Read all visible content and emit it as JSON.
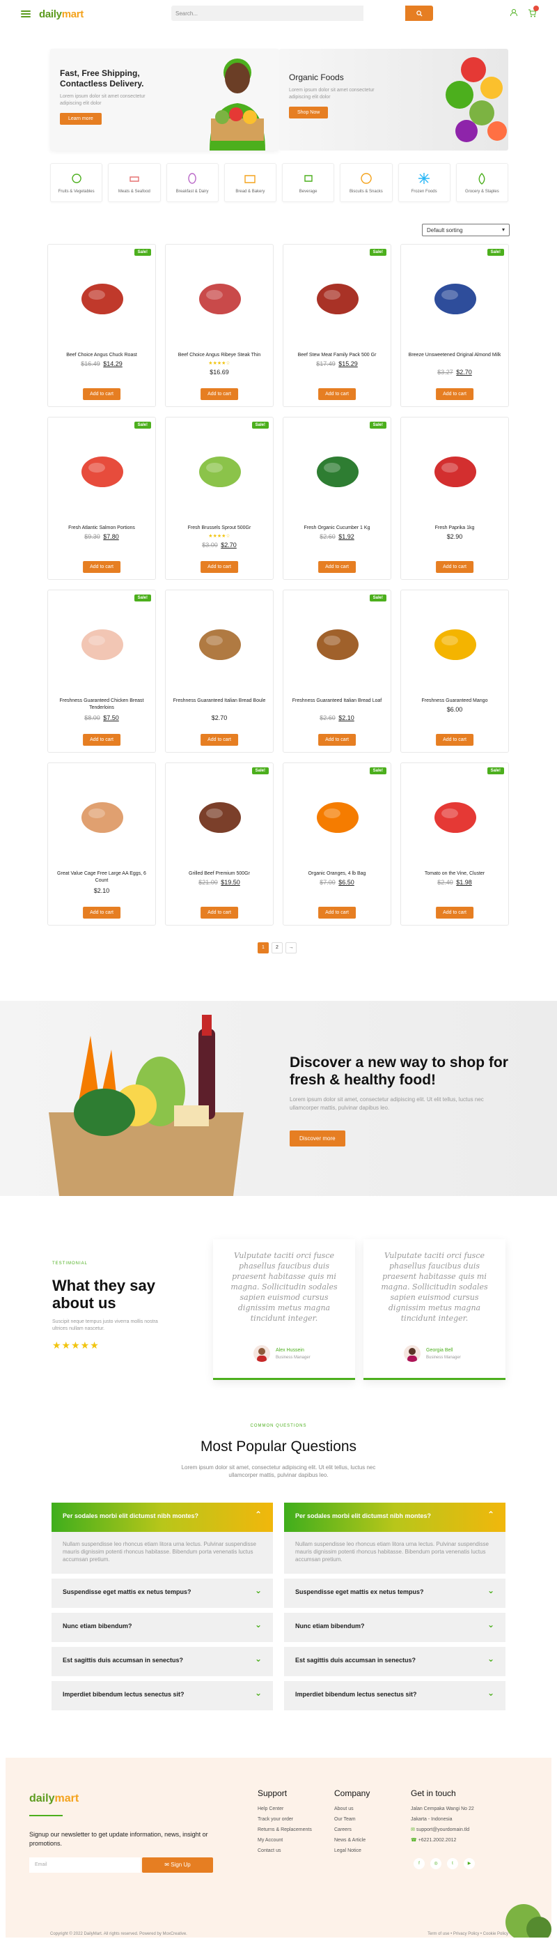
{
  "header": {
    "logo_main": "daily",
    "logo_accent": "mart",
    "search_placeholder": "Search..."
  },
  "banners": [
    {
      "title": "Fast, Free Shipping, Contactless Delivery.",
      "text": "Lorem ipsum dolor sit amet consectetur adipiscing elit dolor",
      "button": "Learn more"
    },
    {
      "title": "Organic Foods",
      "text": "Lorem ipsum dolor sit amet consectetur adipiscing elit dolor",
      "button": "Shop Now"
    }
  ],
  "categories": [
    {
      "label": "Fruits & Vegetables",
      "icon": "fruits-icon"
    },
    {
      "label": "Meats & Seafood",
      "icon": "meat-icon"
    },
    {
      "label": "Breakfast & Dairy",
      "icon": "egg-icon"
    },
    {
      "label": "Bread & Bakery",
      "icon": "bread-icon"
    },
    {
      "label": "Beverage",
      "icon": "coffee-icon"
    },
    {
      "label": "Biscuits & Snacks",
      "icon": "cookie-icon"
    },
    {
      "label": "Frozen Foods",
      "icon": "snowflake-icon"
    },
    {
      "label": "Grocery & Staples",
      "icon": "grocery-icon"
    }
  ],
  "sorting": {
    "selected": "Default sorting"
  },
  "products": [
    {
      "name": "Beef Choice Angus Chuck Roast",
      "old": "$16.49",
      "price": "$14.29",
      "sale": true,
      "stars": "",
      "color": "#c0392b"
    },
    {
      "name": "Beef Choice Angus Ribeye Steak Thin",
      "old": "",
      "price": "$16.69",
      "sale": false,
      "stars": "★★★★☆",
      "color": "#c94a4a"
    },
    {
      "name": "Beef Stew Meat Family Pack 500 Gr",
      "old": "$17.49",
      "price": "$15.29",
      "sale": true,
      "stars": "",
      "color": "#a93226"
    },
    {
      "name": "Breeze Unsweetened Original Almond Milk",
      "old": "$3.27",
      "price": "$2.70",
      "sale": true,
      "stars": "",
      "color": "#2e4d9b"
    },
    {
      "name": "Fresh Atlantic Salmon Portions",
      "old": "$9.30",
      "price": "$7.80",
      "sale": true,
      "stars": "",
      "color": "#e74c3c"
    },
    {
      "name": "Fresh Brussels Sprout 500Gr",
      "old": "$3.00",
      "price": "$2.70",
      "sale": true,
      "stars": "★★★★☆",
      "color": "#8bc34a"
    },
    {
      "name": "Fresh Organic Cucumber 1 Kg",
      "old": "$2.60",
      "price": "$1.92",
      "sale": true,
      "stars": "",
      "color": "#2e7d32"
    },
    {
      "name": "Fresh Paprika 1kg",
      "old": "",
      "price": "$2.90",
      "sale": false,
      "stars": "",
      "color": "#d32f2f"
    },
    {
      "name": "Freshness Guaranteed Chicken Breast Tenderloins",
      "old": "$8.00",
      "price": "$7.50",
      "sale": true,
      "stars": "",
      "color": "#f2c6b4"
    },
    {
      "name": "Freshness Guaranteed Italian Bread Boule",
      "old": "",
      "price": "$2.70",
      "sale": false,
      "stars": "",
      "color": "#b07a42"
    },
    {
      "name": "Freshness Guaranteed Italian Bread Loaf",
      "old": "$2.60",
      "price": "$2.10",
      "sale": true,
      "stars": "",
      "color": "#a0612b"
    },
    {
      "name": "Freshness Guaranteed Mango",
      "old": "",
      "price": "$6.00",
      "sale": false,
      "stars": "",
      "color": "#f4b400"
    },
    {
      "name": "Great Value Cage Free Large AA Eggs, 6 Count",
      "old": "",
      "price": "$2.10",
      "sale": false,
      "stars": "",
      "color": "#e0a070"
    },
    {
      "name": "Grilled Beef Premium 500Gr",
      "old": "$21.00",
      "price": "$19.50",
      "sale": true,
      "stars": "",
      "color": "#7b3f2a"
    },
    {
      "name": "Organic Oranges, 4 lb Bag",
      "old": "$7.00",
      "price": "$6.50",
      "sale": true,
      "stars": "",
      "color": "#f57c00"
    },
    {
      "name": "Tomato on the Vine, Cluster",
      "old": "$2.40",
      "price": "$1.98",
      "sale": true,
      "stars": "",
      "color": "#e53935"
    }
  ],
  "labels": {
    "sale": "Sale!",
    "add_to_cart": "Add to cart"
  },
  "pagination": [
    "1",
    "2",
    "→"
  ],
  "promo": {
    "title": "Discover a new way to shop for fresh & healthy food!",
    "text": "Lorem ipsum dolor sit amet, consectetur adipiscing elit. Ut elit tellus, luctus nec ullamcorper mattis, pulvinar dapibus leo.",
    "button": "Discover more"
  },
  "testimonial": {
    "label": "TESTIMONIAL",
    "title": "What they say about us",
    "sub": "Suscipit neque tempus justo viverra mollis nostra ultrices nullam nascetur.",
    "stars": "★★★★★",
    "items": [
      {
        "quote": "Vulputate taciti orci fusce phasellus faucibus duis praesent habitasse quis mi magna. Sollicitudin sodales sapien euismod cursus dignissim metus magna tincidunt integer.",
        "name": "Alex Hussein",
        "role": "Business Manager"
      },
      {
        "quote": "Vulputate taciti orci fusce phasellus faucibus duis praesent habitasse quis mi magna. Sollicitudin sodales sapien euismod cursus dignissim metus magna tincidunt integer.",
        "name": "Georgia Bell",
        "role": "Business Manager"
      }
    ]
  },
  "faq": {
    "label": "COMMON QUESTIONS",
    "title": "Most Popular Questions",
    "text": "Lorem ipsum dolor sit amet, consectetur adipiscing elit. Ut elit tellus, luctus nec ullamcorper mattis, pulvinar dapibus leo.",
    "answer": "Nullam suspendisse leo rhoncus etiam litora urna lectus. Pulvinar suspendisse mauris dignissim potenti rhoncus habitasse. Bibendum porta venenatis luctus accumsan pretium.",
    "questions": [
      "Per sodales morbi elit dictumst nibh montes?",
      "Suspendisse eget mattis ex netus tempus?",
      "Nunc etiam bibendum?",
      "Est sagittis duis accumsan in senectus?",
      "Imperdiet bibendum lectus senectus sit?"
    ]
  },
  "footer": {
    "news": "Signup our newsletter to get update information, news, insight or promotions.",
    "email_placeholder": "Email",
    "signup": "Sign Up",
    "support_title": "Support",
    "support": [
      "Help Center",
      "Track your order",
      "Returns & Replacements",
      "My Account",
      "Contact us"
    ],
    "company_title": "Company",
    "company": [
      "About us",
      "Our Team",
      "Careers",
      "News & Article",
      "Legal Notice"
    ],
    "contact_title": "Get in touch",
    "contact": [
      "Jalan Cempaka Wangi No 22",
      "Jakarta - Indonesia",
      "support@yourdomain.tld",
      "+6221.2002.2012"
    ],
    "copyright": "Copyright © 2022 DailyMart. All rights reserved. Powered by MoxCreative.",
    "links": "Term of use  •  Privacy Policy  •  Cookie Policy"
  }
}
